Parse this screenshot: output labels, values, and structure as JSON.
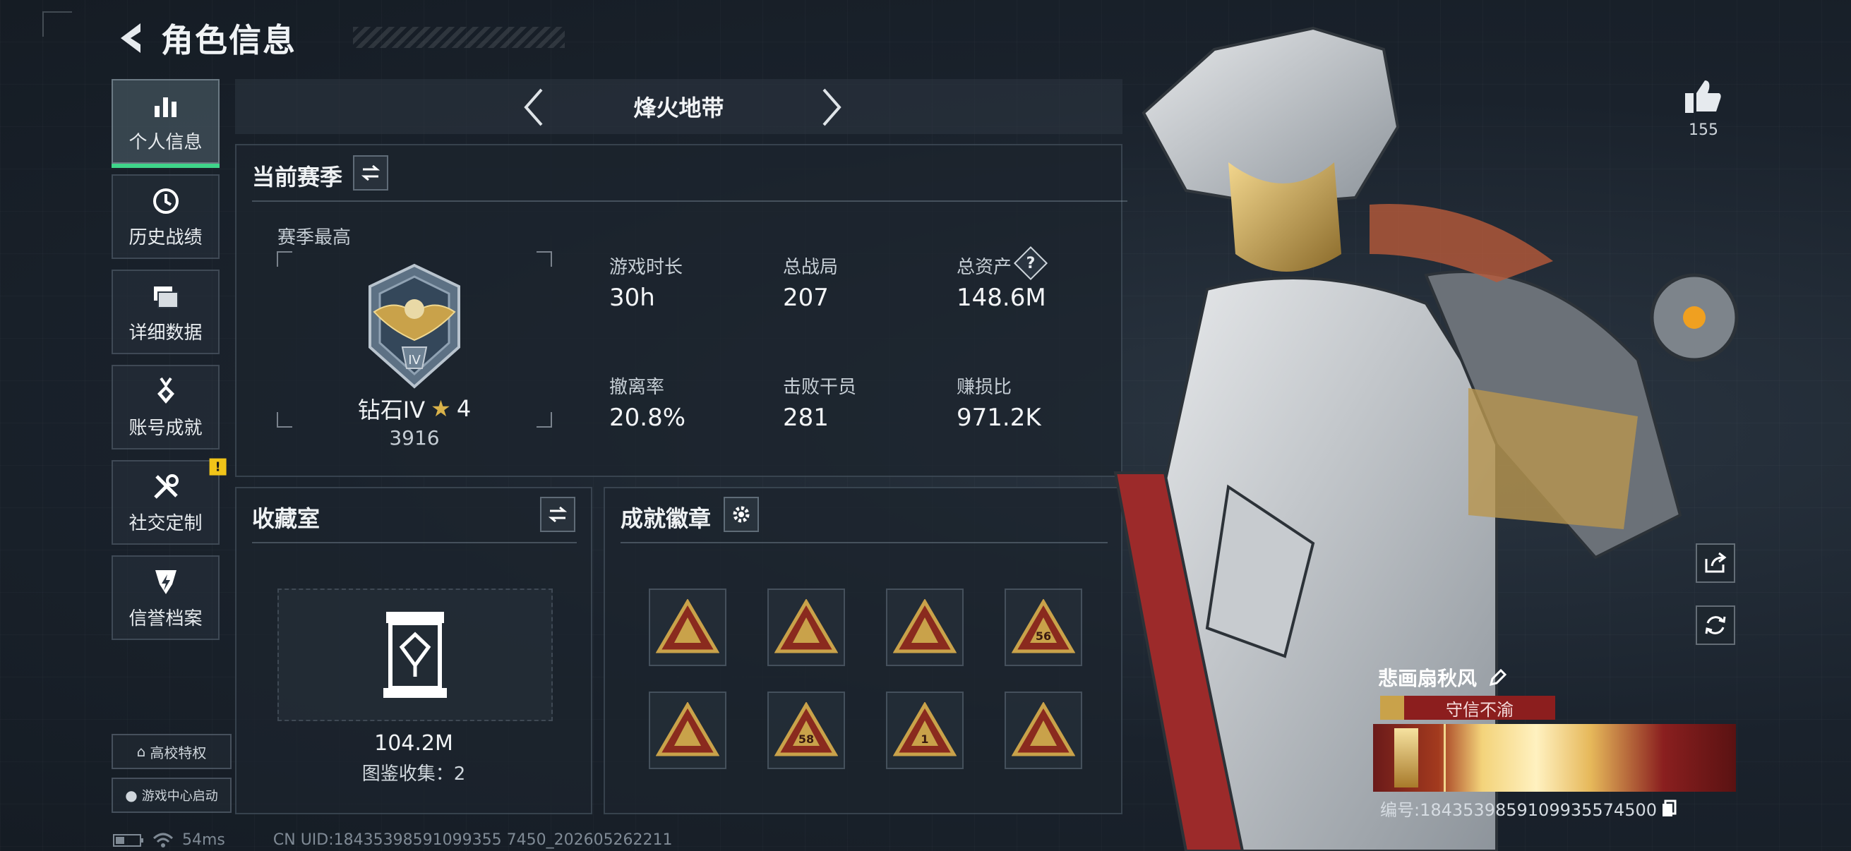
{
  "header": {
    "title": "角色信息"
  },
  "sidebar": {
    "items": [
      {
        "label": "个人信息",
        "icon": "bar-chart-icon",
        "active": true
      },
      {
        "label": "历史战绩",
        "icon": "history-clock-icon"
      },
      {
        "label": "详细数据",
        "icon": "folder-icon"
      },
      {
        "label": "账号成就",
        "icon": "medal-icon"
      },
      {
        "label": "社交定制",
        "icon": "tools-icon",
        "badge": "!"
      },
      {
        "label": "信誉档案",
        "icon": "lightning-shield-icon"
      }
    ],
    "campus_label": "高校特权",
    "game_center_label": "游戏中心启动"
  },
  "mode": {
    "current": "烽火地带"
  },
  "season": {
    "title": "当前赛季",
    "best_label": "赛季最高",
    "rank_name": "钻石IV",
    "rank_stars": "4",
    "rank_score": "3916",
    "stats": [
      {
        "label": "游戏时长",
        "value": "30h"
      },
      {
        "label": "总战局",
        "value": "207"
      },
      {
        "label": "总资产",
        "value": "148.6M",
        "help": "?"
      },
      {
        "label": "撤离率",
        "value": "20.8%"
      },
      {
        "label": "击败干员",
        "value": "281"
      },
      {
        "label": "赚损比",
        "value": "971.2K"
      }
    ]
  },
  "collection": {
    "title": "收藏室",
    "value": "104.2M",
    "collect_label": "图鉴收集：2"
  },
  "achievements": {
    "title": "成就徽章",
    "badges": [
      {
        "icon": "triangle-badge-icon"
      },
      {
        "icon": "triangle-badge-icon"
      },
      {
        "icon": "triangle-badge-icon"
      },
      {
        "icon": "triangle-badge-icon",
        "label": "56"
      },
      {
        "icon": "triangle-badge-icon"
      },
      {
        "icon": "triangle-badge-icon",
        "label": "58"
      },
      {
        "icon": "triangle-badge-icon",
        "label": "1"
      },
      {
        "icon": "triangle-badge-icon"
      }
    ]
  },
  "profile": {
    "likes": "155",
    "name": "悲画扇秋风",
    "honor": "守信不渝",
    "uid_label": "编号:1843539859109935574500"
  },
  "status_bar": {
    "ping": "54ms",
    "uid": "CN UID:18435398591099355 7450_202605262211"
  },
  "colors": {
    "accent_green": "#3fd58a",
    "warn_yellow": "#f0c419",
    "honor_red": "#8c1e1e",
    "badge_gold": "#c9a24a"
  }
}
